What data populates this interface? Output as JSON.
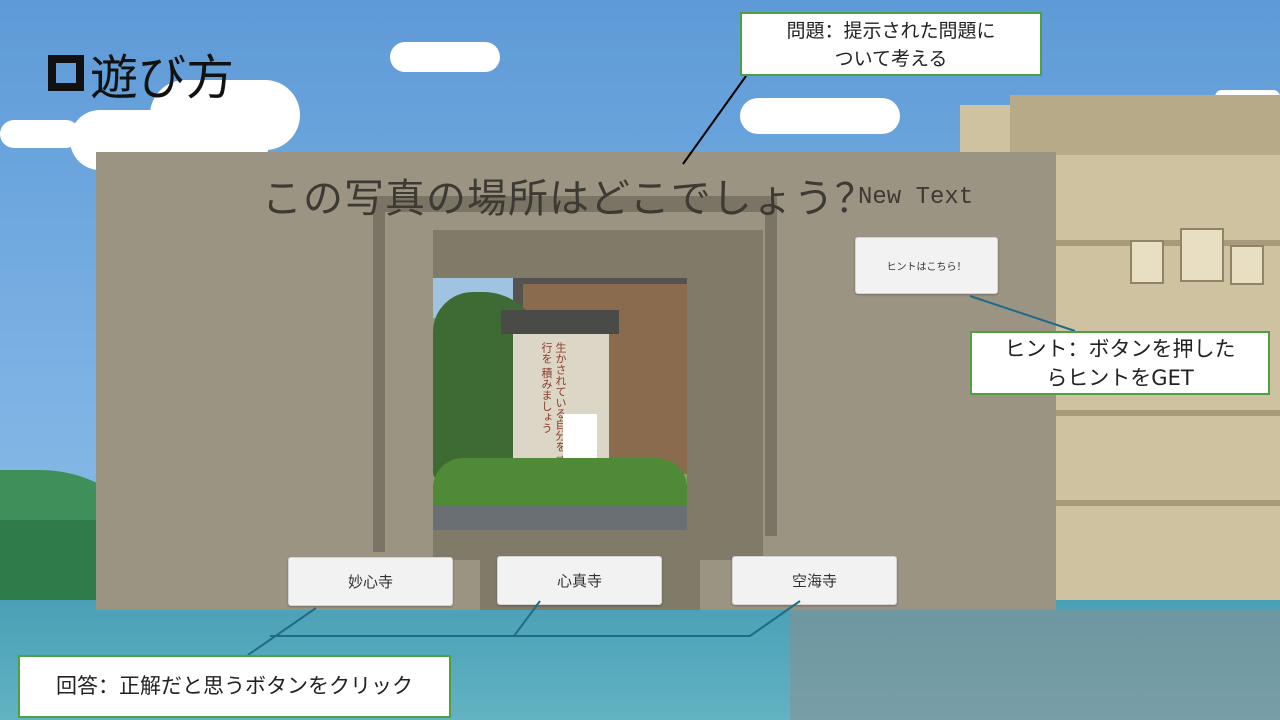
{
  "slide": {
    "title": "遊び方"
  },
  "game": {
    "question": "この写真の場所はどこでしょう？",
    "placeholder_text": "New Text",
    "hint_button_label": "ヒントはこちら！",
    "photo": {
      "sign_text": "生かされている自分を 感謝し報恩の行を 積みましょう"
    },
    "answers": [
      {
        "label": "妙心寺"
      },
      {
        "label": "心真寺"
      },
      {
        "label": "空海寺"
      }
    ]
  },
  "callouts": {
    "question_note": {
      "line1": "問題：提示された問題に",
      "line2": "ついて考える"
    },
    "hint_note": {
      "line1": "ヒント：ボタンを押した",
      "line2": "らヒントをGET"
    },
    "answer_note": "回答：正解だと思うボタンをクリック"
  },
  "colors": {
    "panel": "#9b9483",
    "callout_border": "#4ea040",
    "connector_line": "#1f6b8a"
  }
}
